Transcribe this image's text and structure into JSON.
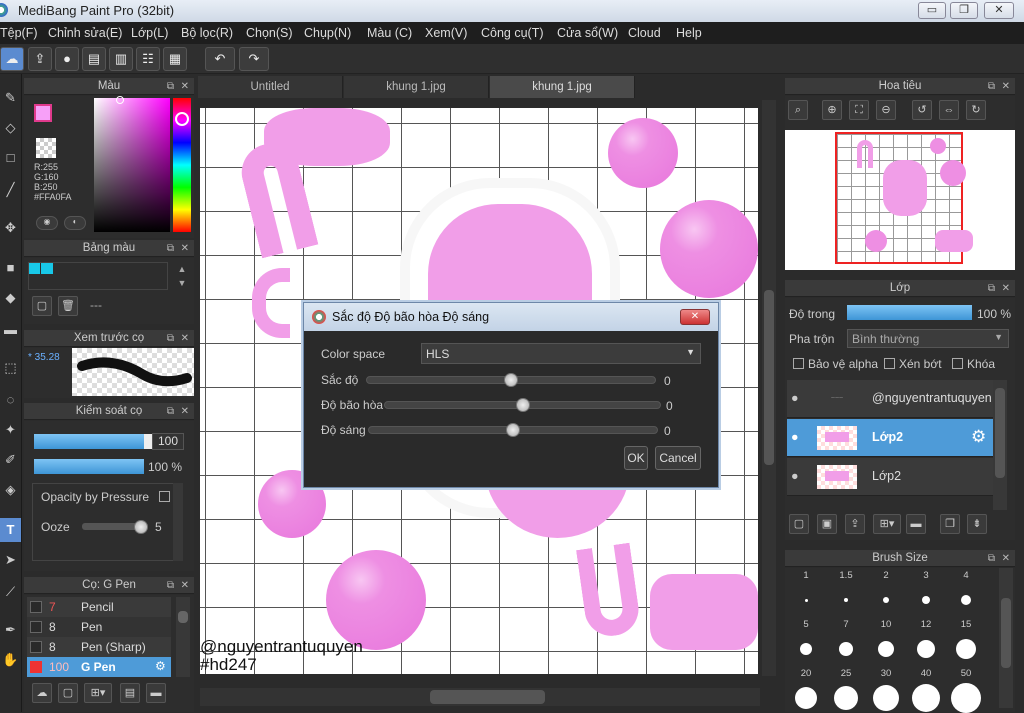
{
  "window": {
    "title": "MediBang Paint Pro (32bit)",
    "min": "▭",
    "max": "❐",
    "close": "✕"
  },
  "menu": [
    "Tệp(F)",
    "Chỉnh sửa(E)",
    "Lớp(L)",
    "Bộ lọc(R)",
    "Chọn(S)",
    "Chụp(N)",
    "Màu (C)",
    "Xem(V)",
    "Công cụ(T)",
    "Cửa sổ(W)",
    "Cloud",
    "Help"
  ],
  "tabs": [
    "Untitled",
    "khung 1.jpg",
    "khung 1.jpg"
  ],
  "color_panel": {
    "title": "Màu",
    "r": "R:255",
    "g": "G:160",
    "b": "B:250",
    "hex": "#FFA0FA",
    "main": "#f7a0f8"
  },
  "palette_panel": {
    "title": "Bảng màu",
    "empty": "---"
  },
  "preview_panel": {
    "title": "Xem trước cọ",
    "size": "35.28"
  },
  "brush_control": {
    "title": "Kiểm soát cọ",
    "size": "100",
    "opacity": "100 %",
    "opacity_by_pressure": "Opacity by Pressure",
    "ooze": "Ooze",
    "ooze_val": "5"
  },
  "brush_list": {
    "title": "Cọ: G Pen",
    "items": [
      {
        "size": "7",
        "name": "Pencil"
      },
      {
        "size": "8",
        "name": "Pen"
      },
      {
        "size": "8",
        "name": "Pen (Sharp)"
      },
      {
        "size": "100",
        "name": "G Pen"
      }
    ]
  },
  "navigator": {
    "title": "Hoa tiêu"
  },
  "layer_panel": {
    "title": "Lớp",
    "opacity_label": "Độ trong",
    "opacity_val": "100 %",
    "blend_label": "Pha trộn",
    "blend_val": "Bình thường",
    "protect_alpha": "Bảo vệ alpha",
    "clip": "Xén bớt",
    "lock": "Khóa",
    "layers": [
      "@nguyentrantuquyen",
      "Lớp2",
      "Lớp2"
    ]
  },
  "brush_size": {
    "title": "Brush Size",
    "sizes": [
      "1",
      "1.5",
      "2",
      "3",
      "4",
      "5",
      "7",
      "10",
      "12",
      "15",
      "20",
      "25",
      "30",
      "40",
      "50"
    ]
  },
  "dialog": {
    "title": "Sắc độ Độ bão hòa Độ sáng",
    "color_space_label": "Color space",
    "color_space": "HLS",
    "hue_label": "Sắc độ",
    "hue_val": "0",
    "sat_label": "Độ bão hòa",
    "sat_val": "0",
    "light_label": "Độ sáng",
    "light_val": "0",
    "ok": "OK",
    "cancel": "Cancel",
    "hue_frac": 0.5,
    "sat_frac": 0.5,
    "light_frac": 0.5
  },
  "watermark": {
    "line1": "@nguyentrantuquyen",
    "line2": "#hd247"
  }
}
